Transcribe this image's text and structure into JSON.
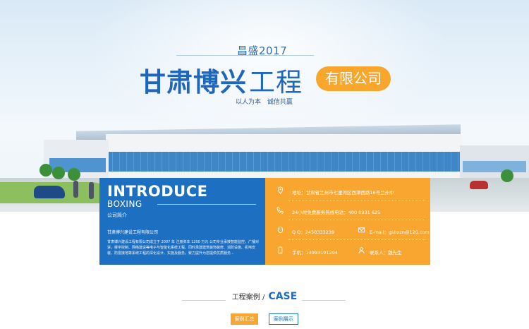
{
  "hero": {
    "year": "昌盛2017",
    "title_bold": "甘肃博兴",
    "title_light": "工程",
    "title_badge": "有限公司",
    "slogan": "以人为本  诚信共赢"
  },
  "intro": {
    "heading": "INTRODUCE",
    "subheading": "BOXING",
    "label": "公司简介",
    "company_name": "甘肃博兴建设工程有限公司",
    "description": "甘肃博兴建设工程有限公司成立于 2007 年  注册资本 1200 万元  公司专业承接智能监控，广播对讲，楼宇控制、网络建设等电子与智能化系统工程，同时承建建筑装饰装修、消防设施、机电安装、防雷接地等系统工程的深化设计、实施及服务。致力提升为您提供优质服务..."
  },
  "contact": {
    "address": "地址：甘肃省兰州市七里河区西津西路16号兰州中",
    "hotline": "24小时免费服务热线电话：400 0931 625",
    "qq": "Q Q：2450333239",
    "email": "E-mail：gsbxzn@126.com",
    "phone": "手机：13993191294",
    "contact_person": "联系人：魏先生"
  },
  "cases": {
    "title_cn": "工程案例 /",
    "title_en": "CASE",
    "btn_summary": "案例汇总",
    "btn_show": "案例展示"
  },
  "colors": {
    "brand_blue": "#1d6fc1",
    "accent_orange": "#f8a630"
  }
}
